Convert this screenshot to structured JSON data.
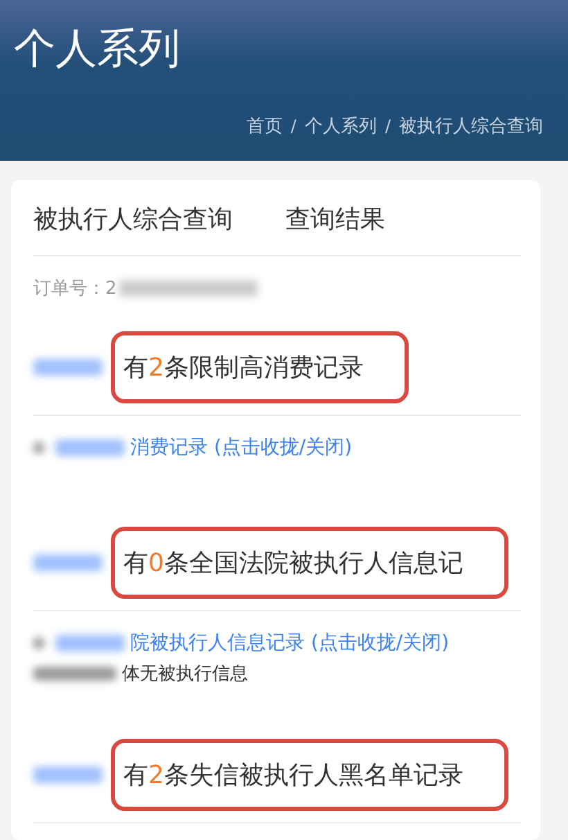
{
  "header": {
    "title": "个人系列",
    "breadcrumb": [
      {
        "label": "首页",
        "separator": "/"
      },
      {
        "label": "个人系列",
        "separator": "/"
      },
      {
        "label": "被执行人综合查询"
      }
    ]
  },
  "card": {
    "tabs": [
      {
        "label": "被执行人综合查询"
      },
      {
        "label": "查询结果"
      }
    ],
    "order_label": "订单号：2",
    "sections": [
      {
        "kind": "summary",
        "before": "有",
        "count": "2",
        "after": "条限制高消费记录"
      },
      {
        "kind": "link",
        "text": "消费记录 (点击收拢/关闭)"
      },
      {
        "kind": "summary",
        "before": "有",
        "count": "0",
        "after": "条全国法院被执行人信息记"
      },
      {
        "kind": "link",
        "text": "院被执行人信息记录 (点击收拢/关闭)",
        "note": "体无被执行信息"
      },
      {
        "kind": "summary",
        "before": "有",
        "count": "2",
        "after": "条失信被执行人黑名单记录"
      }
    ]
  }
}
